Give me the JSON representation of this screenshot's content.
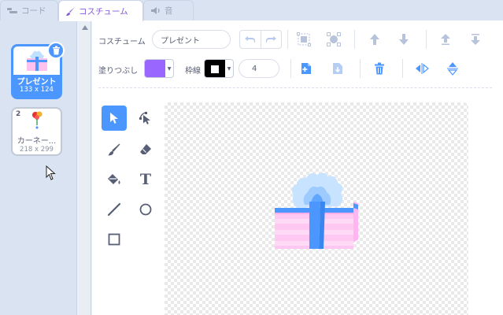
{
  "tabs": {
    "code": "コード",
    "costume": "コスチューム",
    "sound": "音"
  },
  "costumes": [
    {
      "index": "1",
      "name": "プレゼント",
      "size": "133 x 124",
      "selected": true
    },
    {
      "index": "2",
      "name": "カーネー...",
      "size": "218 x 299",
      "selected": false
    }
  ],
  "toolbar": {
    "costume_label": "コスチューム",
    "costume_name": "プレゼント",
    "fill_label": "塗りつぶし",
    "outline_label": "枠線",
    "outline_width": "4"
  },
  "colors": {
    "accent": "#855cd6",
    "primary": "#4c97ff",
    "fill": "#9966ff",
    "outline": "#000000"
  },
  "tools": [
    {
      "name": "select-tool",
      "icon": "arrow-icon",
      "active": true
    },
    {
      "name": "reshape-tool",
      "icon": "reshape-icon",
      "active": false
    },
    {
      "name": "brush-tool",
      "icon": "brush-icon",
      "active": false
    },
    {
      "name": "eraser-tool",
      "icon": "eraser-icon",
      "active": false
    },
    {
      "name": "fill-tool",
      "icon": "bucket-icon",
      "active": false
    },
    {
      "name": "text-tool",
      "icon": "text-icon",
      "active": false
    },
    {
      "name": "line-tool",
      "icon": "line-icon",
      "active": false
    },
    {
      "name": "circle-tool",
      "icon": "circle-icon",
      "active": false
    },
    {
      "name": "rectangle-tool",
      "icon": "rectangle-icon",
      "active": false
    }
  ],
  "text_tool_glyph": "T"
}
